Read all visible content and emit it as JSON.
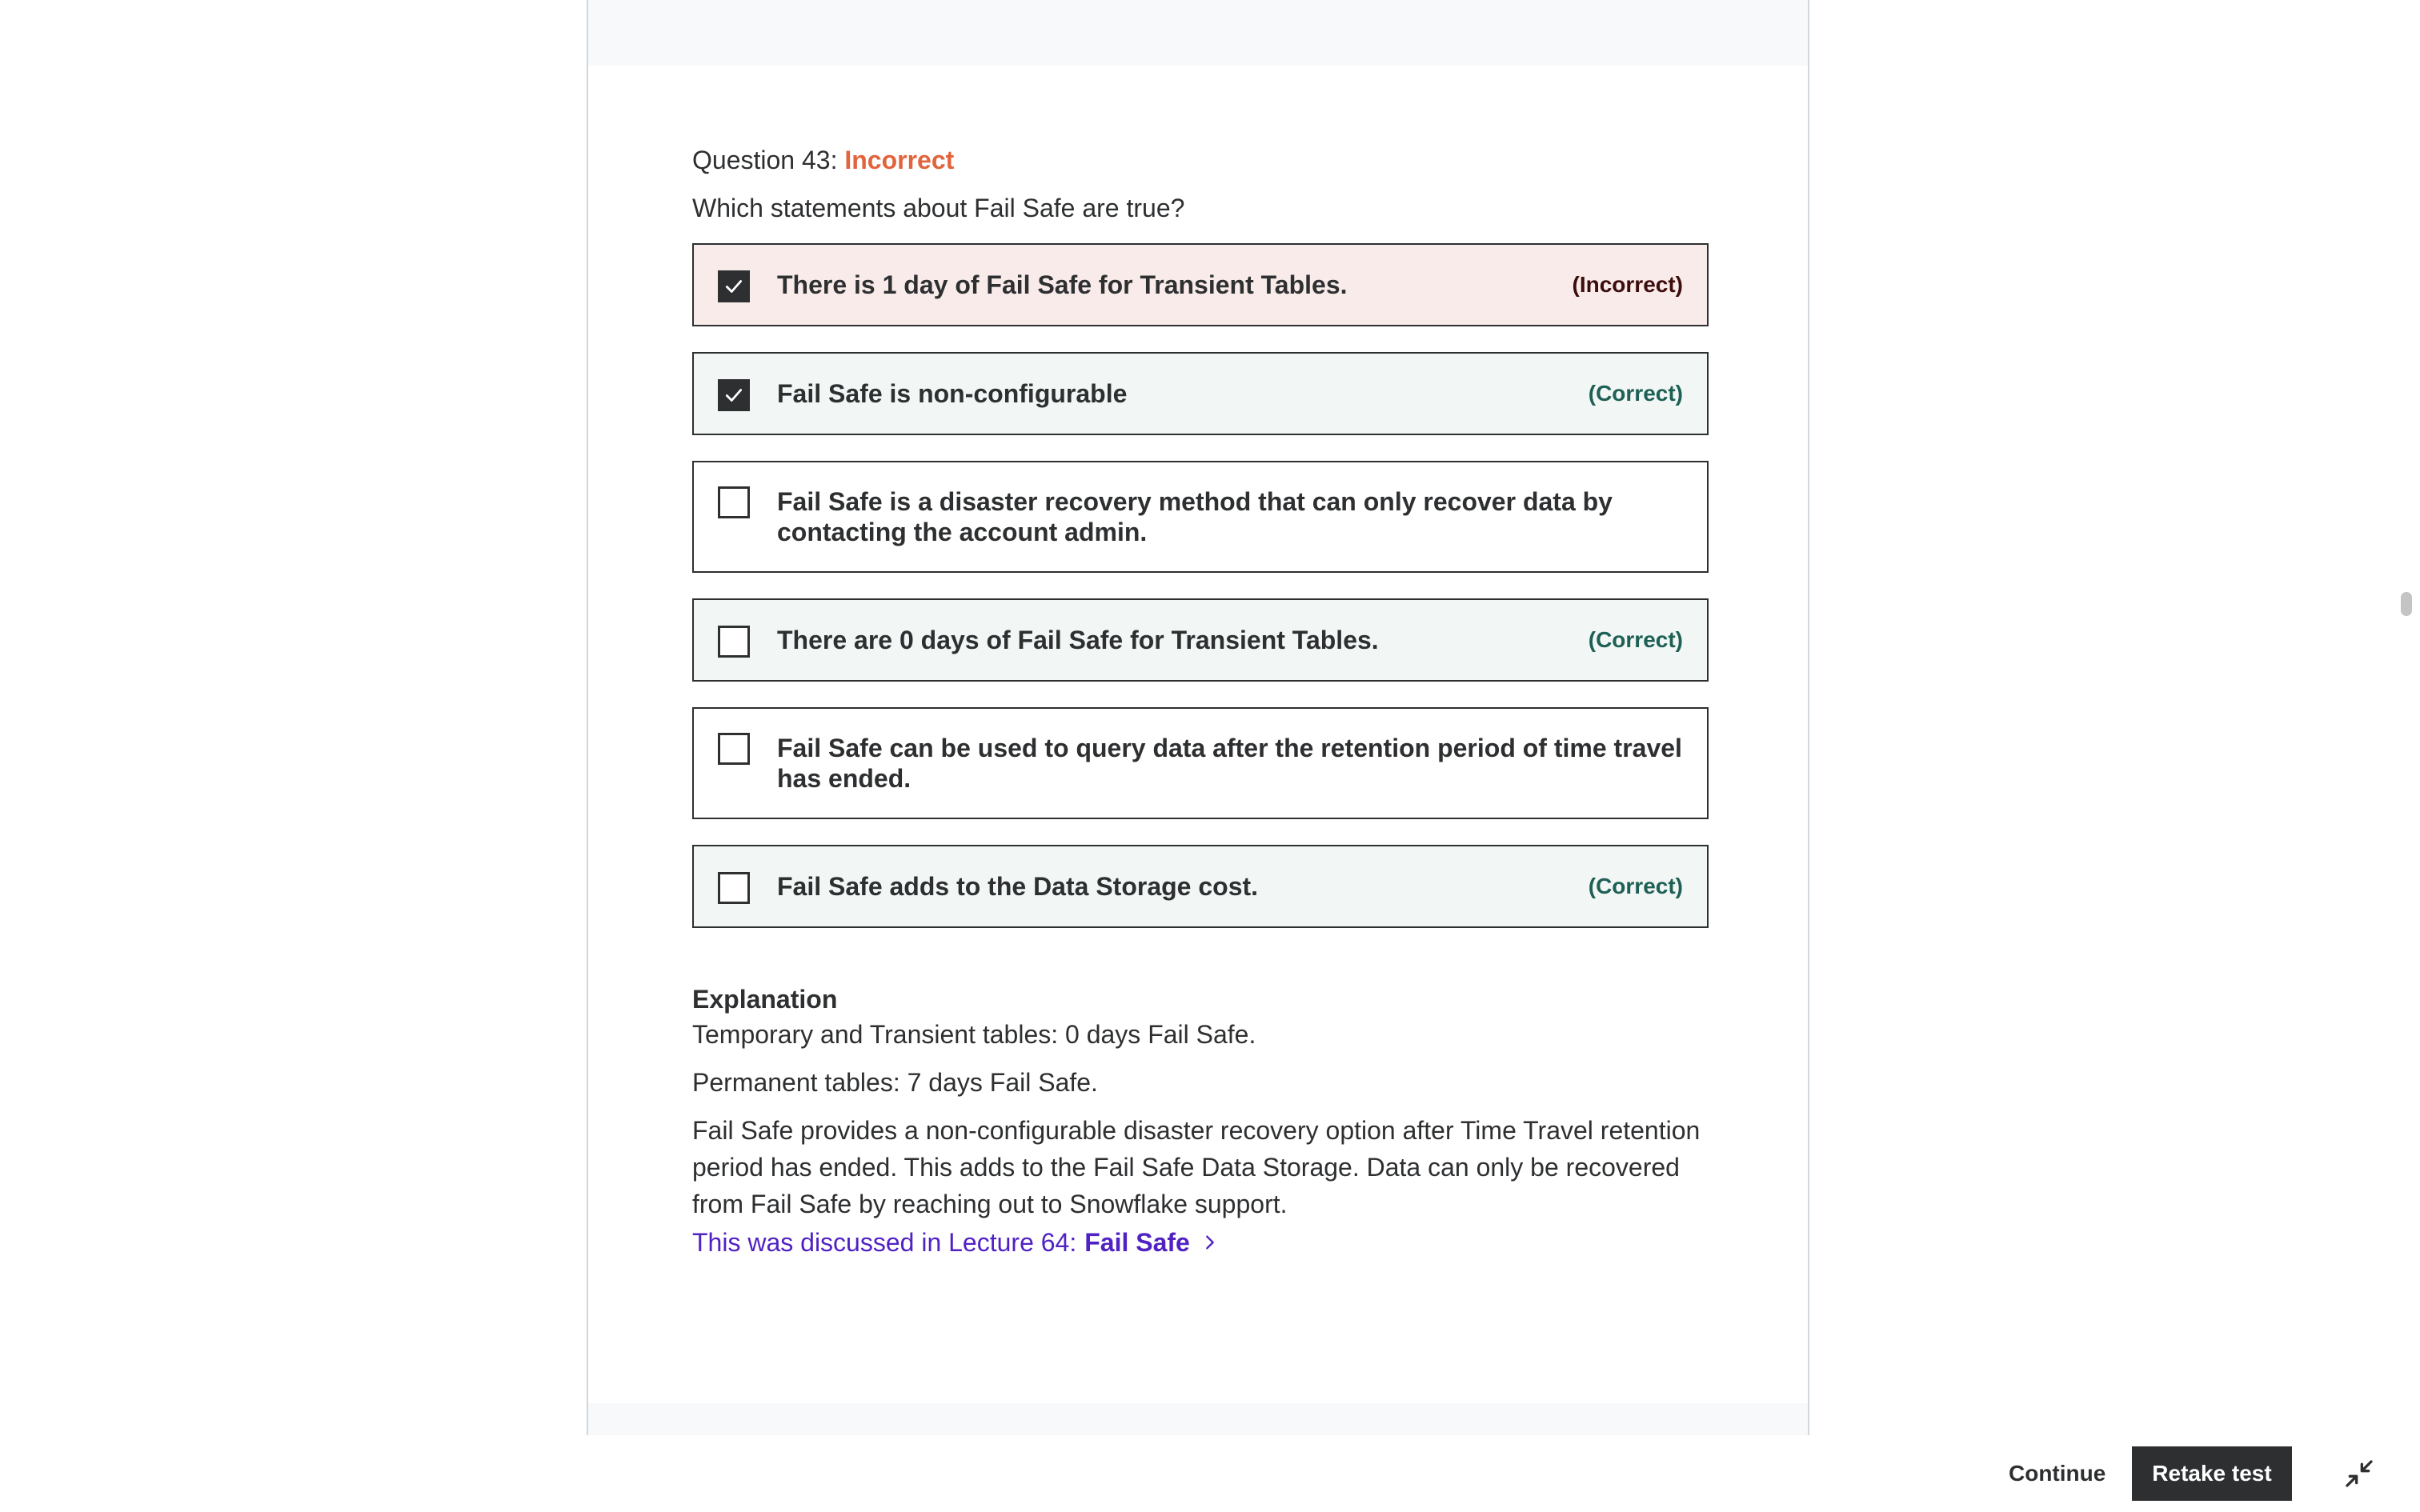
{
  "question": {
    "header_prefix": "Question 43:",
    "status": "Incorrect",
    "prompt": "Which statements about Fail Safe are true?"
  },
  "options": [
    {
      "text": "There is 1 day of Fail Safe for Transient Tables.",
      "checked": true,
      "result": "(Incorrect)"
    },
    {
      "text": "Fail Safe is non-configurable",
      "checked": true,
      "result": "(Correct)"
    },
    {
      "text": "Fail Safe is a disaster recovery method that can only recover data by contacting the account admin.",
      "checked": false,
      "result": ""
    },
    {
      "text": "There are 0 days of Fail Safe for Transient Tables.",
      "checked": false,
      "result": "(Correct)"
    },
    {
      "text": "Fail Safe can be used to query data after the retention period of time travel has ended.",
      "checked": false,
      "result": ""
    },
    {
      "text": "Fail Safe adds to the Data Storage cost.",
      "checked": false,
      "result": "(Correct)"
    }
  ],
  "explanation": {
    "title": "Explanation",
    "paragraphs": [
      "Temporary and Transient tables: 0 days Fail Safe.",
      "Permanent tables: 7 days Fail Safe.",
      "Fail Safe provides a non-configurable disaster recovery option after Time Travel retention period has ended. This adds to the Fail Safe Data Storage. Data can only be recovered from Fail Safe by reaching out to Snowflake support."
    ],
    "link_prefix": "This was discussed in Lecture 64:",
    "link_title": "Fail Safe"
  },
  "footer": {
    "continue_label": "Continue",
    "retake_label": "Retake test"
  },
  "icons": {
    "checkbox_checked": "check-icon",
    "link_arrow": "chevron-right-icon",
    "collapse": "collapse-icon"
  },
  "colors": {
    "incorrect_status": "#e2643c",
    "incorrect_bg": "#f8ebe9",
    "correct_bg": "#f2f6f5",
    "correct_text": "#1e6055",
    "link": "#5022c3",
    "dark": "#2d2f31"
  }
}
